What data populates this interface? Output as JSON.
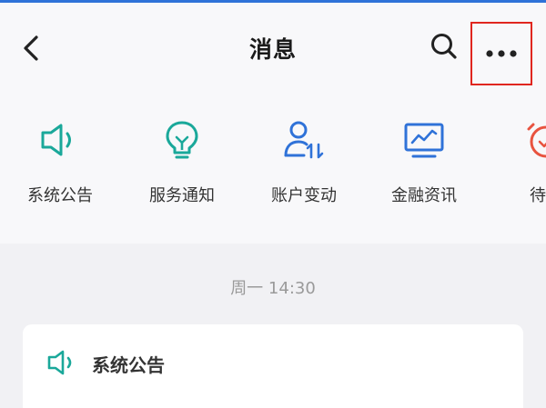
{
  "header": {
    "title": "消息",
    "back_icon": "chevron-left-icon",
    "search_icon": "search-icon",
    "more_icon": "more-dots-icon"
  },
  "categories": [
    {
      "label": "系统公告",
      "icon": "speaker-icon",
      "color": "#1aa89a"
    },
    {
      "label": "服务通知",
      "icon": "lightbulb-icon",
      "color": "#1aa89a"
    },
    {
      "label": "账户变动",
      "icon": "user-transfer-icon",
      "color": "#2f72d8"
    },
    {
      "label": "金融资讯",
      "icon": "monitor-chart-icon",
      "color": "#2f72d8"
    },
    {
      "label": "待办",
      "icon": "clock-icon",
      "color": "#e8533f"
    }
  ],
  "feed": {
    "timestamp": "周一 14:30",
    "card_title": "系统公告"
  },
  "colors": {
    "teal": "#1aa89a",
    "blue": "#2f72d8",
    "red": "#e8533f",
    "highlight": "#e0261f"
  }
}
